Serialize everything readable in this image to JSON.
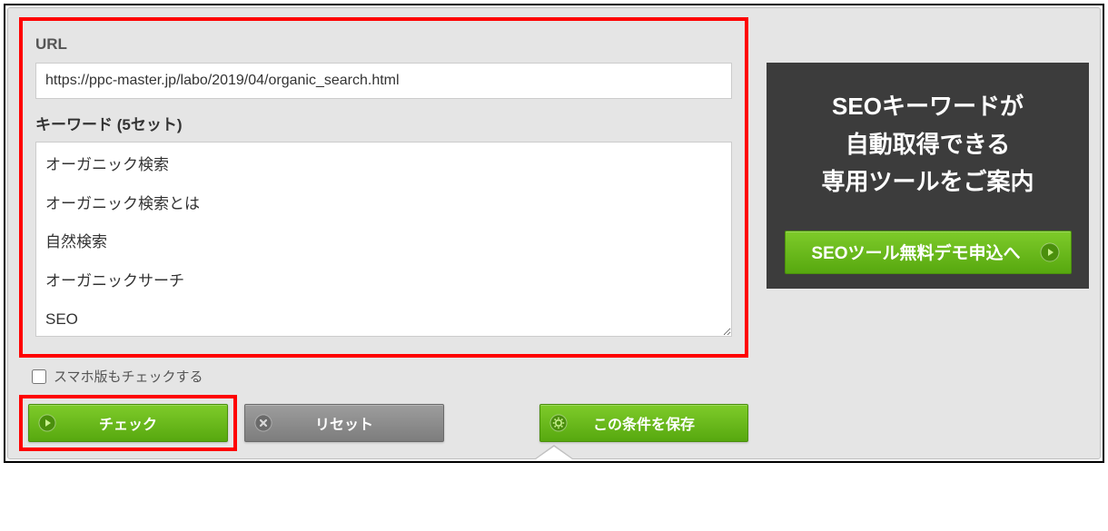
{
  "form": {
    "url_label": "URL",
    "url_value": "https://ppc-master.jp/labo/2019/04/organic_search.html",
    "keywords_label": "キーワード (5セット)",
    "keywords_value": "オーガニック検索\nオーガニック検索とは\n自然検索\nオーガニックサーチ\nSEO",
    "checkbox_label": "スマホ版もチェックする",
    "checkbox_checked": false
  },
  "buttons": {
    "check": "チェック",
    "reset": "リセット",
    "save": "この条件を保存"
  },
  "promo": {
    "line1": "SEOキーワードが",
    "line2": "自動取得できる",
    "line3": "専用ツールをご案内",
    "cta": "SEOツール無料デモ申込へ"
  },
  "colors": {
    "highlight": "#ff0000",
    "green_top": "#7ecb2a",
    "green_bottom": "#57a80f",
    "gray_top": "#9d9d9d",
    "gray_bottom": "#7d7d7d",
    "promo_bg": "#3c3c3c",
    "panel_bg": "#e5e5e5"
  }
}
